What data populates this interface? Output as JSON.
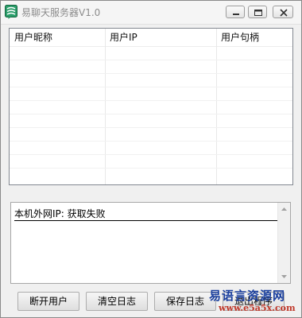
{
  "window": {
    "title": "易聊天服务器V1.0",
    "icon": "app-logo-icon"
  },
  "titlebar_buttons": {
    "minimize_icon": "minimize-icon",
    "maximize_icon": "maximize-icon",
    "close_icon": "close-icon"
  },
  "user_list": {
    "columns": [
      "用户昵称",
      "用户IP",
      "用户句柄"
    ],
    "rows": []
  },
  "log": {
    "lines": [
      "本机外网IP: 获取失败"
    ]
  },
  "buttons": {
    "disconnect": "断开用户",
    "clear_log": "清空日志",
    "save_log": "保存日志",
    "exit": "退出程序"
  },
  "watermark": {
    "text_cn": "易语言资源网",
    "url": "www.e5a5x.com"
  },
  "colors": {
    "watermark_blue": "#1a3f9e",
    "watermark_red": "#c0392b",
    "icon_green": "#1e8c5a"
  }
}
